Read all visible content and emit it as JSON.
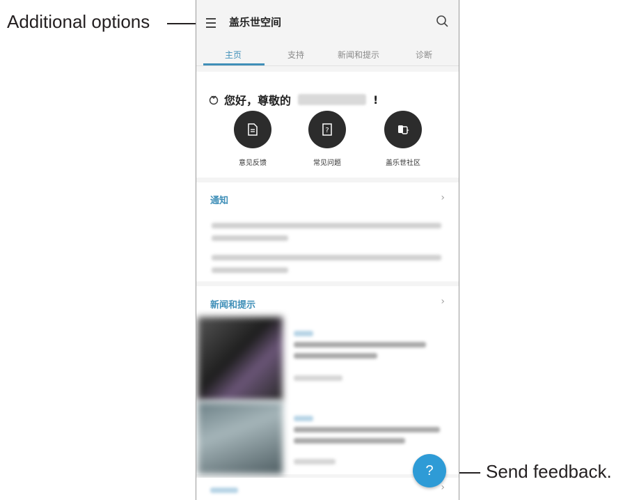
{
  "callouts": {
    "additional_options": "Additional options",
    "send_feedback": "Send feedback."
  },
  "app": {
    "title": "盖乐世空间",
    "icons": {
      "menu": "menu-icon",
      "search": "search-icon"
    }
  },
  "tabs": [
    {
      "label": "主页",
      "active": true
    },
    {
      "label": "支持",
      "active": false
    },
    {
      "label": "新闻和提示",
      "active": false
    },
    {
      "label": "诊断",
      "active": false
    }
  ],
  "greeting": {
    "prefix": "您好，尊敬的",
    "suffix": "!"
  },
  "quick_actions": [
    {
      "label": "意见反馈",
      "icon": "document-icon"
    },
    {
      "label": "常见问题",
      "icon": "faq-icon"
    },
    {
      "label": "盖乐世社区",
      "icon": "community-icon"
    }
  ],
  "notifications": {
    "title": "通知"
  },
  "news": {
    "title": "新闻和提示"
  },
  "fab": {
    "label": "?"
  },
  "colors": {
    "accent": "#3f8fb8",
    "fab": "#2e9bd6",
    "dark_button": "#2c2c2c"
  }
}
